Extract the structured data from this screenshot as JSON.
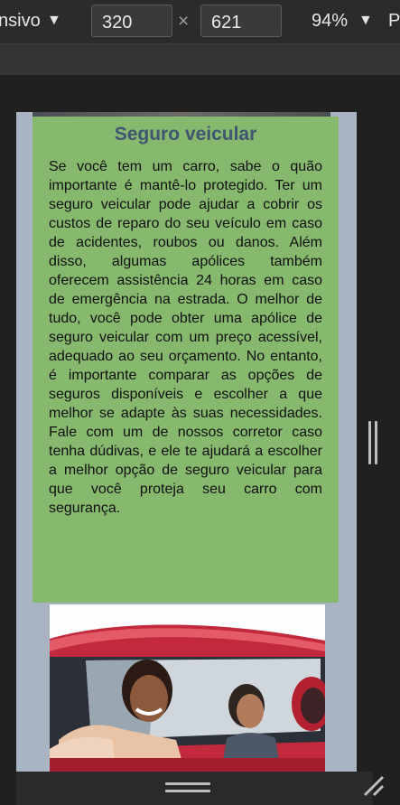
{
  "toolbar": {
    "device_label": "nsivo",
    "width_value": "320",
    "height_value": "621",
    "zoom": "94%",
    "extra": "P"
  },
  "article": {
    "title": "Seguro veicular",
    "body": "Se você tem um carro, sabe o quão importante é mantê-lo protegido. Ter um seguro veicular pode ajudar a cobrir os custos de reparo do seu veículo em caso de acidentes, roubos ou danos. Além disso, algumas apólices também oferecem assistência 24 horas em caso de emergência na estrada. O melhor de tudo, você pode obter uma apólice de seguro veicular com um preço acessível, adequado ao seu orçamento. No entanto, é importante comparar as opções de seguros disponíveis e escolher a que melhor se adapte às suas necessidades. Fale com um de nossos corretor caso tenha dúdivas, e ele te ajudará a escolher a melhor opção de seguro veicular para que você proteja seu carro com segurança."
  },
  "colors": {
    "card_bg": "#86b86e",
    "title": "#3f5572",
    "page_bg": "#a9b4c3"
  },
  "icons": [
    "caret-down-icon",
    "resize-handle-icon",
    "drag-grip-icon"
  ]
}
